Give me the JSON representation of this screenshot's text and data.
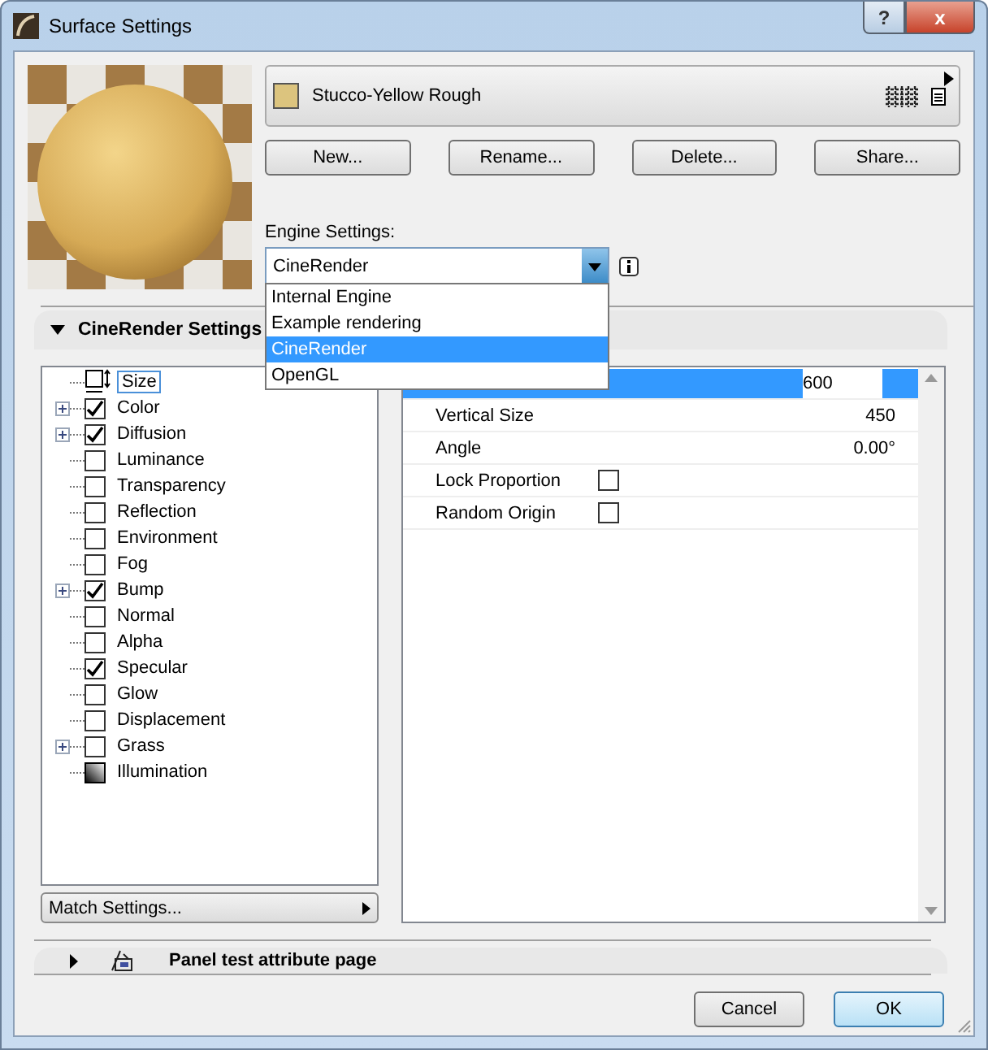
{
  "window": {
    "title": "Surface Settings",
    "help_button": "?",
    "close_button": "x"
  },
  "preview": {
    "kind": "picture"
  },
  "material": {
    "name": "Stucco-Yellow Rough",
    "color": "#dcc47e"
  },
  "buttons": [
    "New...",
    "Rename...",
    "Delete...",
    "Share..."
  ],
  "engine": {
    "label": "Engine Settings:",
    "value": "CineRender",
    "options": [
      {
        "label": "Internal Engine",
        "selected": false
      },
      {
        "label": "Example rendering",
        "selected": false
      },
      {
        "label": "CineRender",
        "selected": true
      },
      {
        "label": "OpenGL",
        "selected": false
      }
    ]
  },
  "panel": {
    "title": "CineRender Settings",
    "expanded": true
  },
  "channels": [
    {
      "label": "Size",
      "kind": "size",
      "expandable": false,
      "selected": true
    },
    {
      "label": "Color",
      "kind": "checkbox",
      "checked": true,
      "expandable": true,
      "selected": false
    },
    {
      "label": "Diffusion",
      "kind": "checkbox",
      "checked": true,
      "expandable": true,
      "selected": false
    },
    {
      "label": "Luminance",
      "kind": "checkbox",
      "checked": false,
      "expandable": false,
      "selected": false
    },
    {
      "label": "Transparency",
      "kind": "checkbox",
      "checked": false,
      "expandable": false,
      "selected": false
    },
    {
      "label": "Reflection",
      "kind": "checkbox",
      "checked": false,
      "expandable": false,
      "selected": false
    },
    {
      "label": "Environment",
      "kind": "checkbox",
      "checked": false,
      "expandable": false,
      "selected": false
    },
    {
      "label": "Fog",
      "kind": "checkbox",
      "checked": false,
      "expandable": false,
      "selected": false
    },
    {
      "label": "Bump",
      "kind": "checkbox",
      "checked": true,
      "expandable": true,
      "selected": false
    },
    {
      "label": "Normal",
      "kind": "checkbox",
      "checked": false,
      "expandable": false,
      "selected": false
    },
    {
      "label": "Alpha",
      "kind": "checkbox",
      "checked": false,
      "expandable": false,
      "selected": false
    },
    {
      "label": "Specular",
      "kind": "checkbox",
      "checked": true,
      "expandable": false,
      "selected": false
    },
    {
      "label": "Glow",
      "kind": "checkbox",
      "checked": false,
      "expandable": false,
      "selected": false
    },
    {
      "label": "Displacement",
      "kind": "checkbox",
      "checked": false,
      "expandable": false,
      "selected": false
    },
    {
      "label": "Grass",
      "kind": "checkbox",
      "checked": false,
      "expandable": true,
      "selected": false
    },
    {
      "label": "Illumination",
      "kind": "illumination",
      "expandable": false,
      "selected": false
    }
  ],
  "match_settings": "Match Settings...",
  "properties": [
    {
      "kind": "value",
      "value": "600",
      "selected": true
    },
    {
      "kind": "value",
      "label": "Vertical Size",
      "value": "450",
      "selected": false
    },
    {
      "kind": "value",
      "label": "Angle",
      "value": "0.00°",
      "selected": false
    },
    {
      "kind": "checkbox",
      "label": "Lock Proportion",
      "checked": false,
      "selected": false
    },
    {
      "kind": "checkbox",
      "label": "Random Origin",
      "checked": false,
      "selected": false
    }
  ],
  "collapsed_panel": {
    "title": "Panel test attribute page",
    "expanded": false
  },
  "footer_buttons": [
    {
      "label": "Cancel",
      "default": false
    },
    {
      "label": "OK",
      "default": true
    }
  ]
}
